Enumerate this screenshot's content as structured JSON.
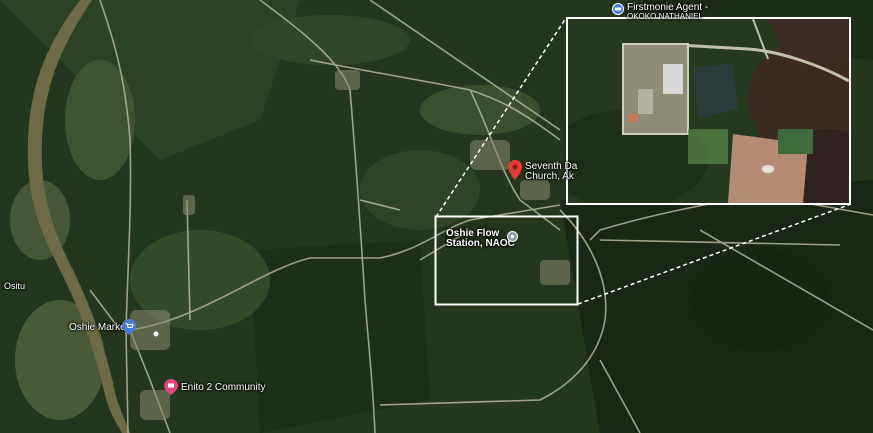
{
  "map": {
    "type": "satellite",
    "colors": {
      "forest_dark": "#1b2a16",
      "forest": "#2c4024",
      "field": "#4b5a37",
      "river": "#6d6a45",
      "road": "#b7b49b",
      "pin_red": "#e53935",
      "pin_blue": "#4a7bd6",
      "pin_pink": "#e0477a",
      "pin_gray": "#8a9aa8"
    },
    "labels": {
      "firstmonie_1": "Firstmonie Agent -",
      "firstmonie_2": "OKOKO NATHANIEL",
      "church_1": "Seventh Da",
      "church_2": "Church, Ak",
      "flow_station_1": "Oshie Flow",
      "flow_station_2": "Station, NAOC",
      "ositu": "Ositu",
      "oshie_market": "Oshie Market",
      "enito": "Enito 2 Community"
    },
    "icons": {
      "firstmonie": "atm-icon",
      "church": "location-pin-icon",
      "flow_station": "place-icon",
      "market": "shopping-cart-icon",
      "enito": "community-icon"
    }
  }
}
